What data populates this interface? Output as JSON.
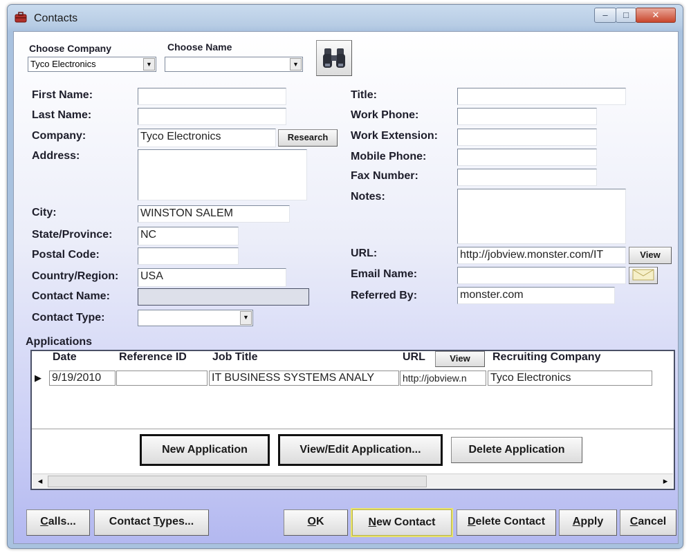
{
  "window": {
    "title": "Contacts",
    "min_glyph": "–",
    "max_glyph": "□",
    "close_glyph": "✕"
  },
  "choose": {
    "company_label": "Choose Company",
    "company_value": "Tyco Electronics",
    "name_label": "Choose Name",
    "name_value": ""
  },
  "left": {
    "first_name_label": "First Name:",
    "first_name": "",
    "last_name_label": "Last Name:",
    "last_name": "",
    "company_label": "Company:",
    "company": "Tyco Electronics",
    "research_label": "Research",
    "address_label": "Address:",
    "address": "",
    "city_label": "City:",
    "city": "WINSTON SALEM",
    "state_label": "State/Province:",
    "state": "NC",
    "postal_label": "Postal Code:",
    "postal": "",
    "country_label": "Country/Region:",
    "country": "USA",
    "contact_name_label": "Contact Name:",
    "contact_name": "",
    "contact_type_label": "Contact Type:",
    "contact_type": ""
  },
  "right": {
    "title_label": "Title:",
    "title": "",
    "work_phone_label": "Work Phone:",
    "work_phone": "",
    "work_ext_label": "Work Extension:",
    "work_ext": "",
    "mobile_label": "Mobile Phone:",
    "mobile": "",
    "fax_label": "Fax Number:",
    "fax": "",
    "notes_label": "Notes:",
    "notes": "",
    "url_label": "URL:",
    "url": "http://jobview.monster.com/IT",
    "url_view_label": "View",
    "email_label": "Email Name:",
    "email": "",
    "referred_label": "Referred By:",
    "referred": "monster.com"
  },
  "applications": {
    "section_label": "Applications",
    "headers": {
      "date": "Date",
      "ref": "Reference ID",
      "job": "Job Title",
      "url": "URL",
      "view": "View",
      "company": "Recruiting Company"
    },
    "rows": [
      {
        "date": "9/19/2010",
        "ref": "",
        "job": "IT BUSINESS SYSTEMS ANALY",
        "url": "http://jobview.n",
        "company": "Tyco Electronics"
      }
    ],
    "row_indicator": "▶",
    "new_label": "New Application",
    "view_edit_label": "View/Edit Application...",
    "delete_label": "Delete Application",
    "scroll_left": "◂",
    "scroll_right": "▸"
  },
  "footer": {
    "calls_u": "C",
    "calls_rest": "alls...",
    "types_a": "Contact ",
    "types_u": "T",
    "types_b": "ypes...",
    "ok_u": "O",
    "ok_rest": "K",
    "new_u": "N",
    "new_rest": "ew Contact",
    "delete_u": "D",
    "delete_rest": "elete Contact",
    "apply_u": "A",
    "apply_rest": "pply",
    "cancel_u": "C",
    "cancel_rest": "ancel"
  }
}
